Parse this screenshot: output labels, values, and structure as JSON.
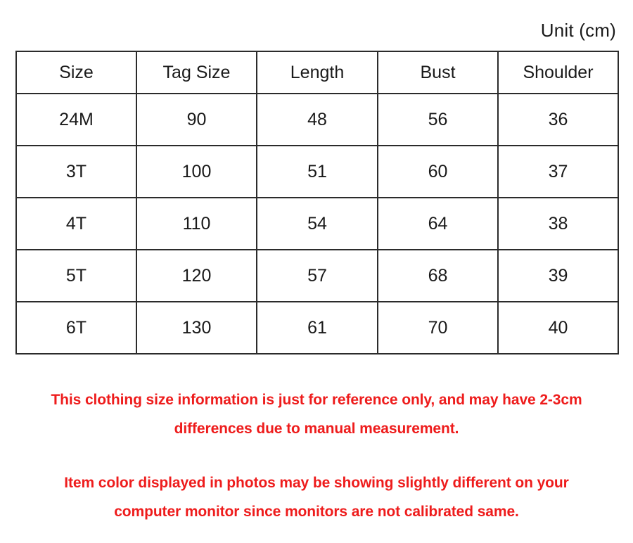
{
  "caption": {
    "unit": "Unit (cm)"
  },
  "table": {
    "columns": [
      "Size",
      "Tag Size",
      "Length",
      "Bust",
      "Shoulder"
    ],
    "rows": [
      {
        "size": "24M",
        "tag_size": "90",
        "length": "48",
        "bust": "56",
        "shoulder": "36"
      },
      {
        "size": "3T",
        "tag_size": "100",
        "length": "51",
        "bust": "60",
        "shoulder": "37"
      },
      {
        "size": "4T",
        "tag_size": "110",
        "length": "54",
        "bust": "64",
        "shoulder": "38"
      },
      {
        "size": "5T",
        "tag_size": "120",
        "length": "57",
        "bust": "68",
        "shoulder": "39"
      },
      {
        "size": "6T",
        "tag_size": "130",
        "length": "61",
        "bust": "70",
        "shoulder": "40"
      }
    ]
  },
  "notes": {
    "measurement": "This clothing size information is just for reference only, and may have 2-3cm differences due to manual measurement.",
    "color": "Item color displayed in photos may be showing slightly different on your computer monitor since monitors are not calibrated same."
  },
  "colors": {
    "note_red": "#ee1c1c",
    "table_border": "#2b2b2b",
    "text": "#1a1a1a",
    "background": "#ffffff"
  }
}
